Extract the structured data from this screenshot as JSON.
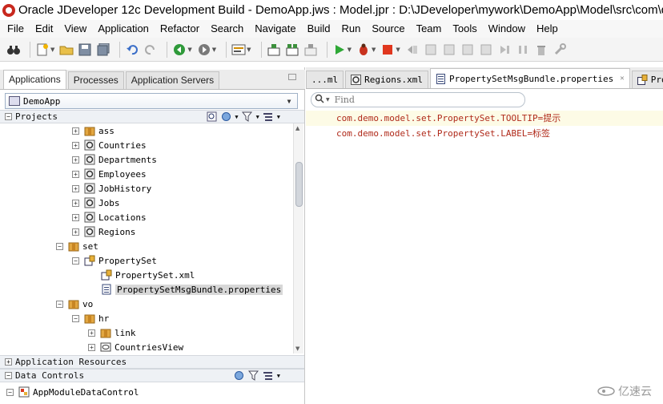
{
  "window": {
    "title": "Oracle JDeveloper 12c Development Build - DemoApp.jws : Model.jpr : D:\\JDeveloper\\mywork\\DemoApp\\Model\\src\\com\\de"
  },
  "menubar": {
    "items": [
      "File",
      "Edit",
      "View",
      "Application",
      "Refactor",
      "Search",
      "Navigate",
      "Build",
      "Run",
      "Source",
      "Team",
      "Tools",
      "Window",
      "Help"
    ]
  },
  "toolbar": {
    "icons": [
      "binoculars-icon",
      "new-icon",
      "open-folder-icon",
      "save-icon",
      "save-all-icon",
      "undo-icon",
      "redo-icon",
      "back-icon",
      "forward-icon",
      "sql-icon",
      "make-icon",
      "rebuild-icon",
      "clean-icon",
      "run-icon",
      "debug-icon",
      "stop-icon",
      "step-icon"
    ]
  },
  "navigator": {
    "tabs": [
      "Applications",
      "Processes",
      "Application Servers"
    ],
    "active_tab": "Applications",
    "application": "DemoApp",
    "sections": {
      "projects": "Projects",
      "application_resources": "Application Resources",
      "data_controls": "Data Controls"
    },
    "tree": [
      {
        "label": "ass",
        "icon": "package-icon",
        "toggle": "+"
      },
      {
        "label": "Countries",
        "icon": "entity-icon",
        "toggle": "+"
      },
      {
        "label": "Departments",
        "icon": "entity-icon",
        "toggle": "+"
      },
      {
        "label": "Employees",
        "icon": "entity-icon",
        "toggle": "+"
      },
      {
        "label": "JobHistory",
        "icon": "entity-icon",
        "toggle": "+"
      },
      {
        "label": "Jobs",
        "icon": "entity-icon",
        "toggle": "+"
      },
      {
        "label": "Locations",
        "icon": "entity-icon",
        "toggle": "+"
      },
      {
        "label": "Regions",
        "icon": "entity-icon",
        "toggle": "+"
      },
      {
        "label": "set",
        "icon": "package-icon",
        "toggle": "−"
      },
      {
        "label": "PropertySet",
        "icon": "property-set-icon",
        "toggle": "−"
      },
      {
        "label": "PropertySet.xml",
        "icon": "xml-file-icon",
        "toggle": ""
      },
      {
        "label": "PropertySetMsgBundle.properties",
        "icon": "properties-file-icon",
        "toggle": ""
      },
      {
        "label": "vo",
        "icon": "package-icon",
        "toggle": "−"
      },
      {
        "label": "hr",
        "icon": "package-icon",
        "toggle": "−"
      },
      {
        "label": "link",
        "icon": "package-icon",
        "toggle": "+"
      },
      {
        "label": "CountriesView",
        "icon": "view-object-icon",
        "toggle": "+"
      }
    ],
    "data_controls_tree": [
      {
        "label": "AppModuleDataControl",
        "icon": "data-control-icon",
        "toggle": "−"
      }
    ]
  },
  "editor": {
    "tabs": [
      {
        "label": "...ml",
        "icon": ""
      },
      {
        "label": "Regions.xml",
        "icon": "entity-icon"
      },
      {
        "label": "PropertySetMsgBundle.properties",
        "icon": "properties-file-icon",
        "active": true
      },
      {
        "label": "Proper",
        "icon": "property-set-icon"
      }
    ],
    "find_placeholder": "Find",
    "lines": [
      "com.demo.model.set.PropertySet.TOOLTIP=提示",
      "com.demo.model.set.PropertySet.LABEL=标签"
    ],
    "text_color": "#b02a1a"
  },
  "watermark": {
    "text": "亿速云"
  }
}
